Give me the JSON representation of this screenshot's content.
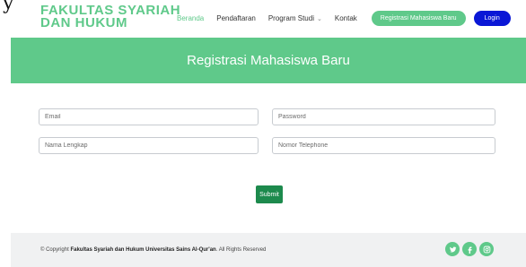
{
  "header": {
    "stray_char": "y",
    "brand_line1": "FAKULTAS SYARIAH",
    "brand_line2": "DAN HUKUM",
    "nav": [
      {
        "label": "Beranda"
      },
      {
        "label": "Pendaftaran"
      },
      {
        "label": "Program Studi"
      },
      {
        "label": "Kontak"
      }
    ],
    "register_button": "Registrasi Mahasiswa Baru",
    "login_button": "Login"
  },
  "hero": {
    "title": "Registrasi Mahasiswa Baru"
  },
  "form": {
    "email_placeholder": "Email",
    "password_placeholder": "Password",
    "name_placeholder": "Nama Lengkap",
    "phone_placeholder": "Nomor Telephone",
    "submit_label": "Submit"
  },
  "footer": {
    "copyright_prefix": "© Copyright ",
    "copyright_org": "Fakultas Syariah dan Hukum Universitas Sains Al-Qur'an",
    "copyright_suffix": ". All Rights Reserved",
    "social_icons": [
      "twitter-icon",
      "facebook-icon",
      "instagram-icon"
    ]
  },
  "colors": {
    "accent": "#5fc98a",
    "login_blue": "#0a17d6",
    "submit_green": "#1d8a4d",
    "footer_bg": "#f0f1f2"
  }
}
